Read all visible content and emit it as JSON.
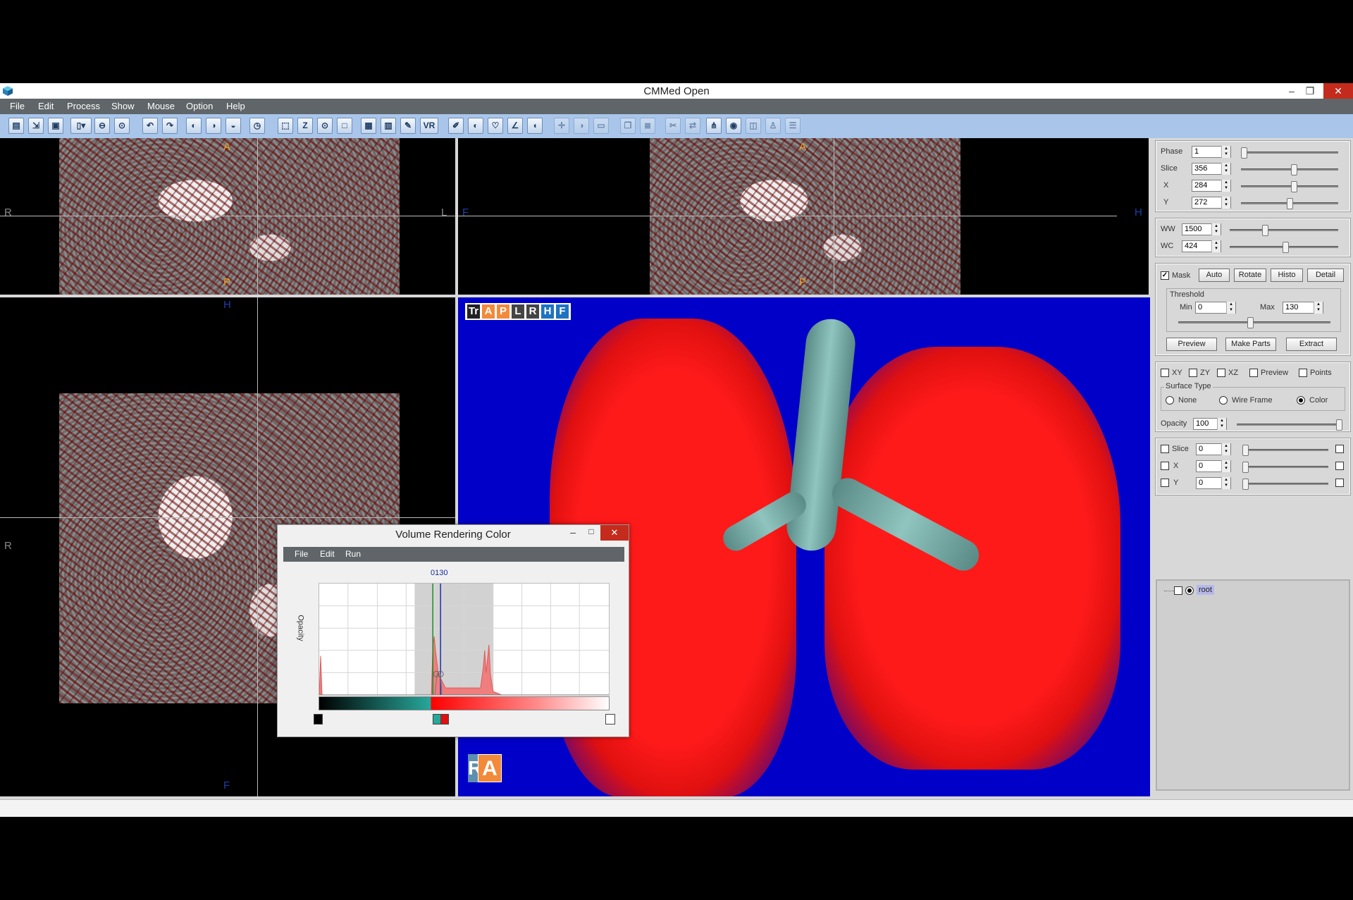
{
  "window": {
    "title": "CMMed  Open"
  },
  "menu": [
    "File",
    "Edit",
    "Process",
    "Show",
    "Mouse",
    "Option",
    "Help"
  ],
  "toolbar_icons": [
    "open-folder-icon",
    "import-icon",
    "save-icon",
    "display-mode-icon",
    "zoom-out-icon",
    "zoom-fit-icon",
    "undo-icon",
    "redo-icon",
    "view-axial-icon",
    "view-coronal-icon",
    "view-sagittal-icon",
    "clock-icon",
    "select-box-icon",
    "z-slice-icon",
    "point-icon",
    "frame-icon",
    "grid-icon",
    "chart-icon",
    "edit-icon",
    "vr-icon",
    "brush-icon",
    "contrast-icon",
    "heart-icon",
    "angle-icon",
    "window-level-icon"
  ],
  "toolbar_labels": {
    "z": "Z",
    "vr": "VR"
  },
  "views": {
    "axial": {
      "top": "A",
      "bottom": "P",
      "left": "R",
      "right": "L"
    },
    "sagittal": {
      "top": "A",
      "bottom": "P",
      "left": "F",
      "right": "H"
    },
    "coronal": {
      "top": "H",
      "bottom": "F",
      "left": "R"
    }
  },
  "vr_badges": [
    {
      "label": "Tr",
      "color": "#222222"
    },
    {
      "label": "A",
      "color": "#f28a3a"
    },
    {
      "label": "P",
      "color": "#f28a3a"
    },
    {
      "label": "L",
      "color": "#444444"
    },
    {
      "label": "R",
      "color": "#444444"
    },
    {
      "label": "H",
      "color": "#1e73c0"
    },
    {
      "label": "F",
      "color": "#1e73c0"
    }
  ],
  "orientation_cube": {
    "left": "R",
    "front": "A"
  },
  "panel": {
    "phase": {
      "label": "Phase",
      "value": "1",
      "pos": 0.0
    },
    "slice": {
      "label": "Slice",
      "value": "356",
      "pos": 0.55
    },
    "x": {
      "label": "X",
      "value": "284",
      "pos": 0.55
    },
    "y": {
      "label": "Y",
      "value": "272",
      "pos": 0.5
    },
    "ww": {
      "label": "WW",
      "value": "1500",
      "pos": 0.32
    },
    "wc": {
      "label": "WC",
      "value": "424",
      "pos": 0.52
    },
    "mask": {
      "label": "Mask",
      "checked": true
    },
    "mask_buttons": [
      "Auto",
      "Rotate",
      "Histo",
      "Detail"
    ],
    "threshold": {
      "title": "Threshold",
      "min_label": "Min",
      "min_value": "0",
      "max_label": "Max",
      "max_value": "130"
    },
    "threshold_buttons": [
      "Preview",
      "Make Parts",
      "Extract"
    ],
    "planes": [
      {
        "label": "XY",
        "checked": false
      },
      {
        "label": "ZY",
        "checked": false
      },
      {
        "label": "XZ",
        "checked": false
      },
      {
        "label": "Preview",
        "checked": false
      },
      {
        "label": "Points",
        "checked": false
      }
    ],
    "surface_type": {
      "title": "Surface Type",
      "options": [
        "None",
        "Wire Frame",
        "Color"
      ],
      "selected": "Color"
    },
    "opacity": {
      "label": "Opacity",
      "value": "100",
      "pos": 1.0
    },
    "clip": [
      {
        "label": "Slice",
        "value": "0"
      },
      {
        "label": "X",
        "value": "0"
      },
      {
        "label": "Y",
        "value": "0"
      }
    ],
    "tree": {
      "root": "root"
    }
  },
  "dialog": {
    "title": "Volume Rendering Color",
    "menu": [
      "File",
      "Edit",
      "Run"
    ],
    "y_label": "Opacity",
    "marker_value": "0130",
    "x_min": -1024,
    "x_max": 2048
  },
  "colors": {
    "accent": "#a9c6ea",
    "vr_background": "#0000c8",
    "volume": "#ff1a1a",
    "close": "#c42b1c"
  }
}
